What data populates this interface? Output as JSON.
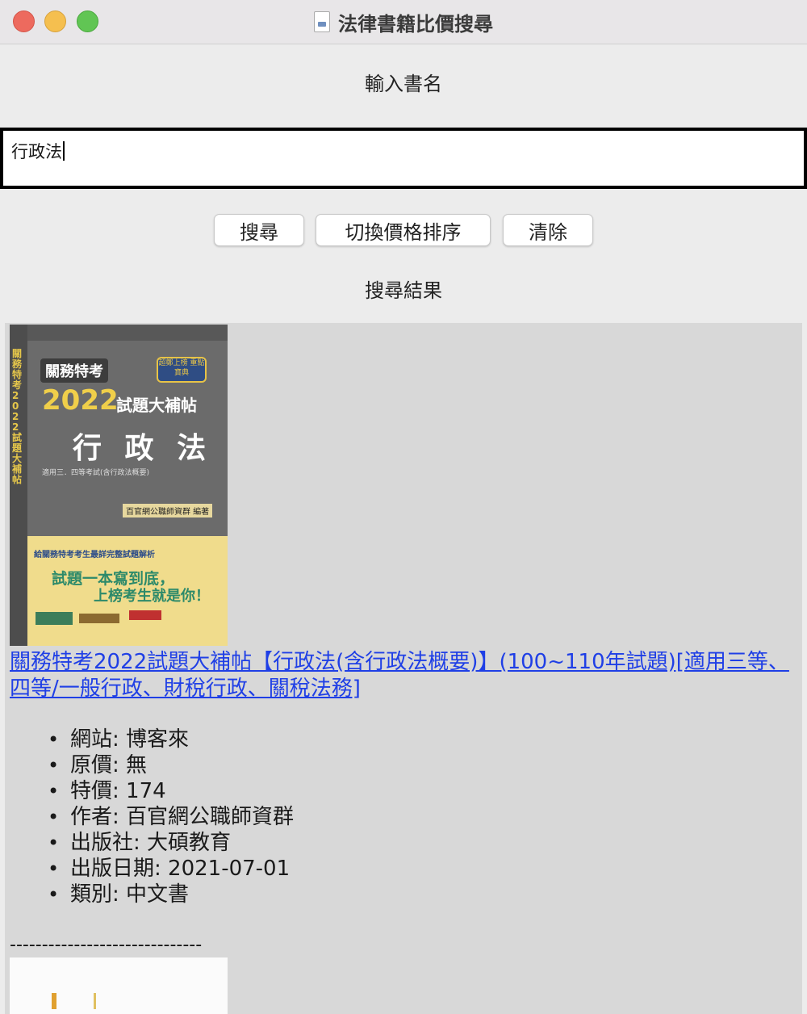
{
  "window": {
    "title": "法律書籍比價搜尋"
  },
  "input_section": {
    "heading": "輸入書名",
    "search_value": "行政法"
  },
  "buttons": {
    "search": "搜尋",
    "toggle_sort": "切換價格排序",
    "clear": "清除"
  },
  "results_section": {
    "heading": "搜尋結果"
  },
  "results": [
    {
      "title": "關務特考2022試題大補帖【行政法(含行政法概要)】(100~110年試題)[適用三等、四等/一般行政、財稅行政、關稅法務]",
      "cover": {
        "series": "關務特考",
        "badge": "超鄭上榜 重點寶典",
        "year": "2022",
        "subtitle": "試題大補帖",
        "main": "行 政 法",
        "note": "適用三．四等考試(含行政法概要)",
        "publisher_tag": "百官網公職師資群 編著",
        "yellow_line1": "給關務特考考生最詳完整試題解析",
        "yellow_line2": "試題一本寫到底，",
        "yellow_line3": "上榜考生就是你！",
        "spine": "關務特考2022試題大補帖"
      },
      "details": [
        {
          "label": "網站",
          "value": "博客來"
        },
        {
          "label": "原價",
          "value": "無"
        },
        {
          "label": "特價",
          "value": "174"
        },
        {
          "label": "作者",
          "value": "百官網公職師資群"
        },
        {
          "label": "出版社",
          "value": "大碩教育"
        },
        {
          "label": "出版日期",
          "value": "2021-07-01"
        },
        {
          "label": "類別",
          "value": "中文書"
        }
      ],
      "details_text": [
        "網站: 博客來",
        "原價: 無",
        "特價: 174",
        "作者: 百官網公職師資群",
        "出版社: 大碩教育",
        "出版日期: 2021-07-01",
        "類別: 中文書"
      ]
    }
  ],
  "separator": "------------------------------",
  "colors": {
    "link": "#1f3fe6",
    "results_bg": "#d8d8d8",
    "window_bg": "#ececec"
  }
}
